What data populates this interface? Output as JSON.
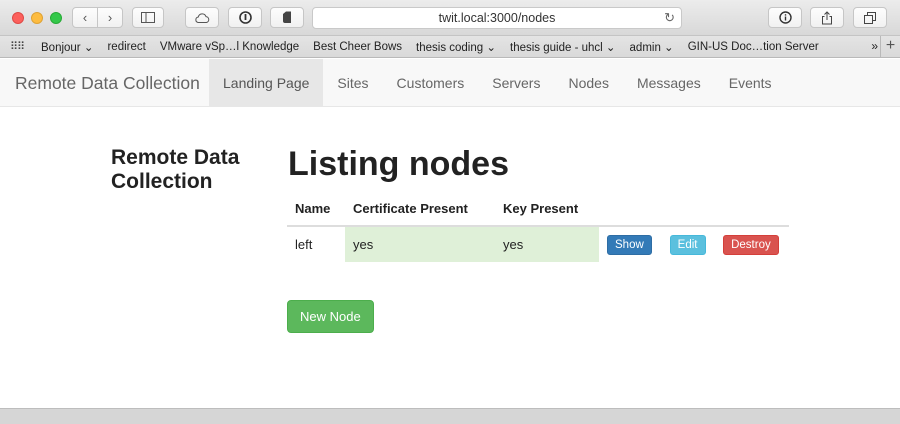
{
  "browser": {
    "url": "twit.local:3000/nodes",
    "bookmarks": [
      "Bonjour ⌄",
      "redirect",
      "VMware vSp…l Knowledge",
      "Best Cheer Bows",
      "thesis coding ⌄",
      "thesis guide - uhcl ⌄",
      "admin ⌄",
      "GIN-US Doc…tion Server"
    ],
    "more": "»",
    "add": "+"
  },
  "navbar": {
    "brand": "Remote Data Collection",
    "links": [
      "Landing Page",
      "Sites",
      "Customers",
      "Servers",
      "Nodes",
      "Messages",
      "Events"
    ]
  },
  "sidebar": {
    "title": "Remote Data Collection"
  },
  "main": {
    "title": "Listing nodes",
    "table": {
      "headers": [
        "Name",
        "Certificate Present",
        "Key Present"
      ],
      "rows": [
        {
          "name": "left",
          "certificate": "yes",
          "key": "yes"
        }
      ]
    },
    "actions": {
      "show": "Show",
      "edit": "Edit",
      "destroy": "Destroy"
    },
    "new_button": "New Node"
  }
}
